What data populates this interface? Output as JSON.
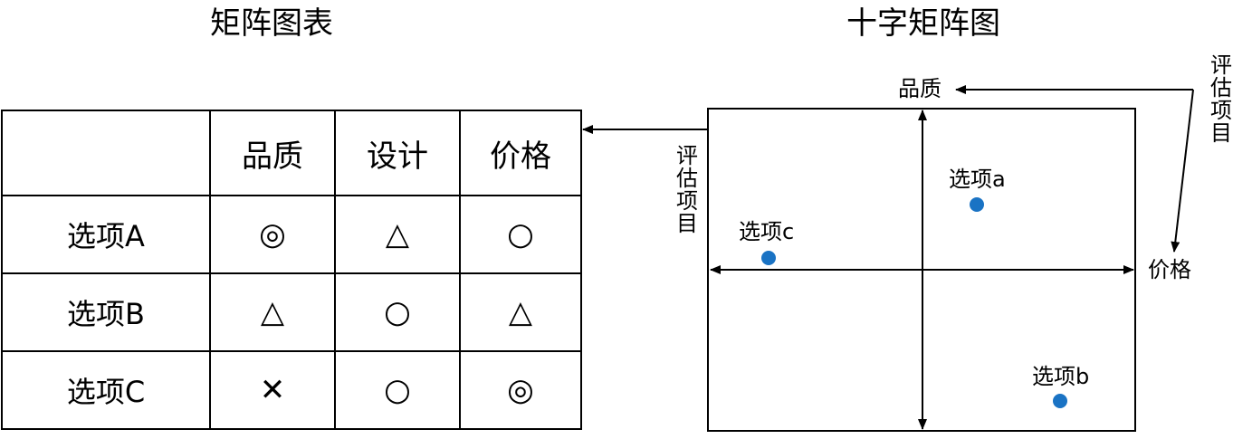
{
  "left_title": "矩阵图表",
  "right_title": "十字矩阵图",
  "table": {
    "headers": [
      "",
      "品质",
      "设计",
      "价格"
    ],
    "rows": [
      {
        "label": "选项A",
        "cells": [
          "◎",
          "△",
          "○"
        ]
      },
      {
        "label": "选项B",
        "cells": [
          "△",
          "○",
          "△"
        ]
      },
      {
        "label": "选项C",
        "cells": [
          "✕",
          "○",
          "◎"
        ]
      }
    ]
  },
  "cross": {
    "axis_top_label": "品质",
    "axis_right_label": "价格",
    "vertical_label_left": "评估项目",
    "vertical_label_right": "评估项目",
    "point_color": "#1a73c4",
    "points": [
      {
        "label": "选项a"
      },
      {
        "label": "选项b"
      },
      {
        "label": "选项c"
      }
    ]
  }
}
